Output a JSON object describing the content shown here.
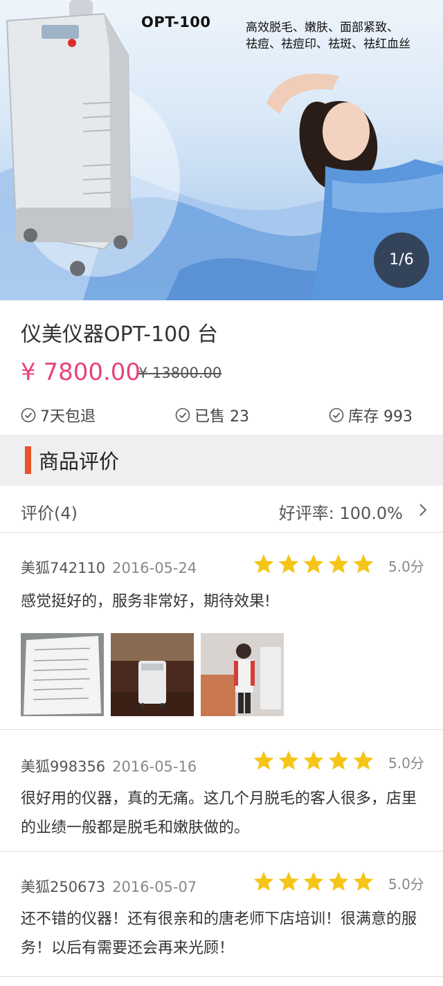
{
  "banner": {
    "model_title": "OPT-100",
    "feature_line_1": "高效脱毛、嫩肤、面部紧致、",
    "feature_line_2": "祛痘、祛痘印、祛斑、祛红血丝",
    "counter": "1/6"
  },
  "product": {
    "name": "仪美仪器OPT-100 台",
    "price": "¥ 7800.00",
    "original_price": "¥ 13800.00",
    "badges": [
      {
        "label": "7天包退",
        "icon": "check-circle-icon"
      },
      {
        "label": "已售 23",
        "icon": "check-circle-icon"
      },
      {
        "label": "库存 993",
        "icon": "check-circle-icon"
      }
    ]
  },
  "reviews_section": {
    "title": "商品评价",
    "count_label": "评价(4)",
    "rate_label": "好评率: 100.0%"
  },
  "reviews": [
    {
      "user": "美狐742110",
      "date": "2016-05-24",
      "stars": 5,
      "score": "5.0分",
      "content": "感觉挺好的，服务非常好，期待效果!",
      "photos": 3
    },
    {
      "user": "美狐998356",
      "date": "2016-05-16",
      "stars": 5,
      "score": "5.0分",
      "content": "很好用的仪器，真的无痛。这几个月脱毛的客人很多，店里的业绩一般都是脱毛和嫩肤做的。",
      "photos": 0
    },
    {
      "user": "美狐250673",
      "date": "2016-05-07",
      "stars": 5,
      "score": "5.0分",
      "content": "还不错的仪器！还有很亲和的唐老师下店培训！很满意的服务！以后有需要还会再来光顾！",
      "photos": 0
    }
  ],
  "colors": {
    "price": "#e8427a",
    "section_accent": "#e8522d",
    "star": "#f5c518"
  }
}
